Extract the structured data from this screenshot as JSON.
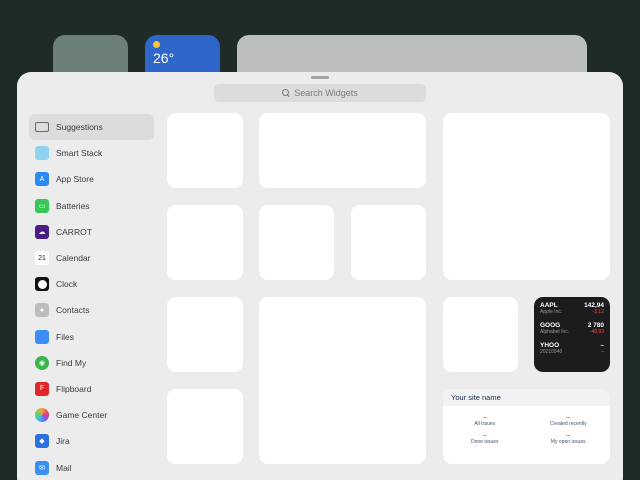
{
  "background": {
    "weather_temp": "26°"
  },
  "search": {
    "placeholder": "Search Widgets"
  },
  "sidebar": {
    "items": [
      {
        "label": "Suggestions",
        "icon": "suggestions-icon"
      },
      {
        "label": "Smart Stack",
        "icon": "smart-stack-icon"
      },
      {
        "label": "App Store",
        "icon": "app-store-icon"
      },
      {
        "label": "Batteries",
        "icon": "batteries-icon"
      },
      {
        "label": "CARROT",
        "icon": "carrot-icon"
      },
      {
        "label": "Calendar",
        "icon": "calendar-icon",
        "badge": "21"
      },
      {
        "label": "Clock",
        "icon": "clock-icon"
      },
      {
        "label": "Contacts",
        "icon": "contacts-icon"
      },
      {
        "label": "Files",
        "icon": "files-icon"
      },
      {
        "label": "Find My",
        "icon": "find-my-icon"
      },
      {
        "label": "Flipboard",
        "icon": "flipboard-icon"
      },
      {
        "label": "Game Center",
        "icon": "game-center-icon"
      },
      {
        "label": "Jira",
        "icon": "jira-icon"
      },
      {
        "label": "Mail",
        "icon": "mail-icon"
      }
    ]
  },
  "stocks": {
    "rows": [
      {
        "symbol": "AAPL",
        "value": "142,94",
        "name": "Apple Inc.",
        "change": "-3,12"
      },
      {
        "symbol": "GOOG",
        "value": "2 780",
        "name": "Alphabet Inc.",
        "change": "-48,93"
      },
      {
        "symbol": "YHOO",
        "value": "–",
        "name": "20210540",
        "change": "–"
      }
    ],
    "negative_color": "#ff453a"
  },
  "jira": {
    "title": "Your site name",
    "cells": [
      {
        "count": "–",
        "label": "All issues"
      },
      {
        "count": "–",
        "label": "Created recently"
      },
      {
        "count": "–",
        "label": "Done issues"
      },
      {
        "count": "–",
        "label": "My open issues"
      }
    ]
  }
}
